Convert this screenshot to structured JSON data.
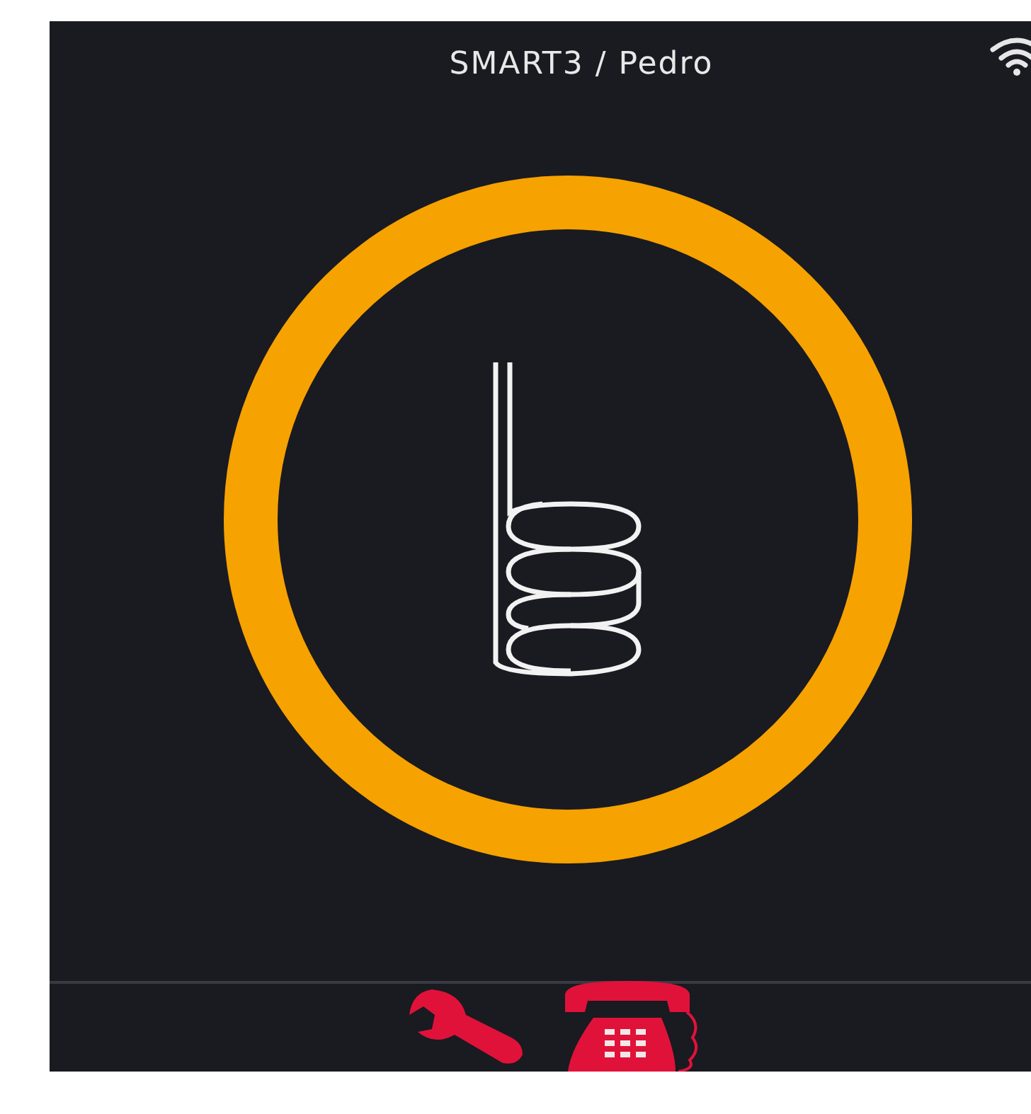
{
  "header": {
    "title": "SMART3 / Pedro"
  },
  "toolbar": [
    {
      "kind": "wrench"
    },
    {
      "kind": "phone"
    }
  ]
}
